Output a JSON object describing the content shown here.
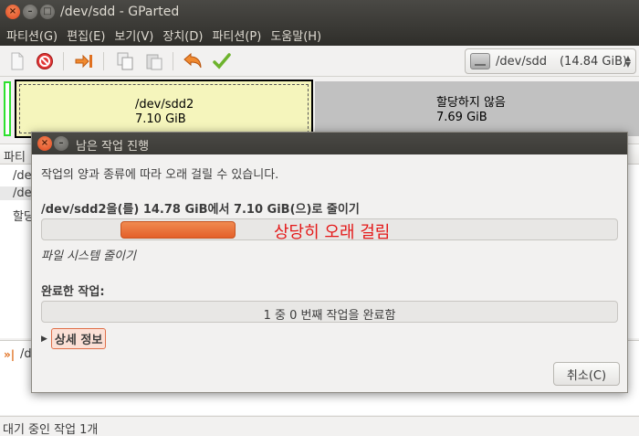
{
  "window": {
    "title": "/dev/sdd - GParted",
    "close_glyph": "×",
    "min_glyph": "–",
    "max_glyph": "□"
  },
  "menubar": {
    "items": [
      {
        "label": "파티션(G)"
      },
      {
        "label": "편집(E)"
      },
      {
        "label": "보기(V)"
      },
      {
        "label": "장치(D)"
      },
      {
        "label": "파티션(P)"
      },
      {
        "label": "도움말(H)"
      }
    ]
  },
  "toolbar": {
    "icons": [
      "new-icon",
      "delete-icon",
      "resize-move-icon",
      "copy-icon",
      "paste-icon",
      "undo-icon",
      "apply-icon"
    ],
    "device": {
      "name": "/dev/sdd",
      "size": "(14.84 GiB)"
    }
  },
  "graph": {
    "partition": {
      "name": "/dev/sdd2",
      "size": "7.10 GiB"
    },
    "unallocated": {
      "name": "할당하지 않음",
      "size": "7.69 GiB"
    }
  },
  "list": {
    "header": "파티",
    "rows": [
      "/de",
      "/de",
      "할당"
    ]
  },
  "pending": {
    "text": "/dev/"
  },
  "statusbar": {
    "text": "대기 중인 작업 1개"
  },
  "dialog": {
    "title": "남은 작업 진행",
    "message": "작업의 양과 종류에 따라 오래 걸릴 수 있습니다.",
    "operation": "/dev/sdd2을(를) 14.78 GiB에서 7.10 GiB(으)로 줄이기",
    "progress_note": "상당히 오래 걸림",
    "sub_status": "파일 시스템 줄이기",
    "done_label": "완료한 작업:",
    "done_text": "1 중 0 번째 작업을 완료함",
    "details_label": "상세 정보",
    "cancel_label": "취소(C)"
  }
}
